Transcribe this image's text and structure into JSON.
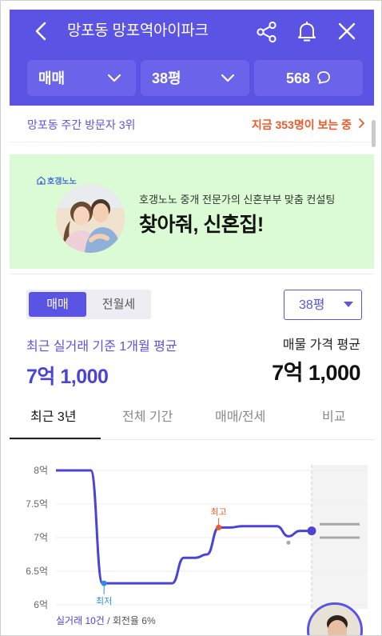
{
  "header": {
    "title": "망포동 망포역아이파크",
    "filters": {
      "trade_type": "매매",
      "size": "38평",
      "comments": "568"
    }
  },
  "visitors": {
    "rank_text": "망포동 주간 방문자 3위",
    "now_viewing": "지금 353명이 보는 중"
  },
  "banner": {
    "logo": "호갱노노",
    "subtitle": "호갱노노 중개 전문가의 신혼부부 맞춤 컨설팅",
    "title": "찾아줘, 신혼집!"
  },
  "price": {
    "segment": [
      "매매",
      "전월세"
    ],
    "size_select": "38평",
    "recent_label": "최근 실거래 기준 1개월 평균",
    "recent_value": "7억 1,000",
    "ask_label": "매물 가격 평균",
    "ask_value": "7억 1,000"
  },
  "tabs": [
    "최근 3년",
    "전체 기간",
    "매매/전세",
    "비교"
  ],
  "chart_data": {
    "type": "line",
    "y_ticks": [
      "8억",
      "7.5억",
      "7억",
      "6.5억",
      "6억"
    ],
    "ylim": [
      6.0,
      8.0
    ],
    "series": [
      {
        "values": [
          8.0,
          8.0,
          8.0,
          8.0,
          6.32,
          6.32,
          6.32,
          6.32,
          6.32,
          6.32,
          6.32,
          6.7,
          6.7,
          6.75,
          7.15,
          7.15,
          7.17,
          7.17,
          7.17,
          7.17,
          7.02,
          7.1,
          7.1
        ]
      }
    ],
    "annotations": {
      "max_label": "최고",
      "min_label": "최저"
    },
    "footer": {
      "trades": "실거래 10건",
      "rest": " / 회전율 6%"
    },
    "colors": {
      "line": "#4b43d8",
      "max": "#ef5a2a",
      "min": "#2f8ee0"
    }
  }
}
